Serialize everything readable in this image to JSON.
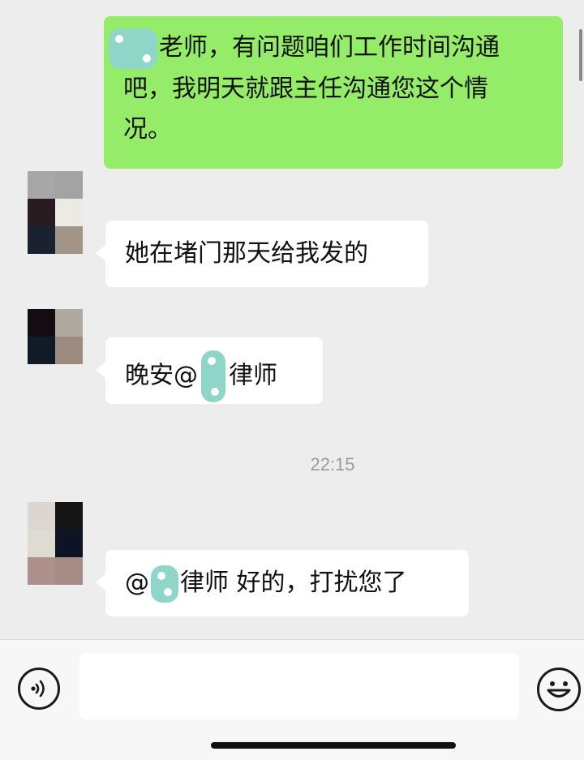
{
  "messages": [
    {
      "id": "m1",
      "direction": "outgoing",
      "text_line1": "老师，有问题咱们工作时间沟通",
      "text_line2": "吧，我明天就跟主任沟通您这个情",
      "text_line3": "况。"
    },
    {
      "id": "m2",
      "direction": "incoming",
      "text": "她在堵门那天给我发的"
    },
    {
      "id": "m3",
      "direction": "incoming",
      "text_before": "晚安@",
      "text_after": "律师"
    },
    {
      "id": "m4",
      "direction": "incoming",
      "text_before": "@",
      "text_after": "律师  好的，打扰您了"
    }
  ],
  "timestamp": "22:15",
  "input_bar": {
    "voice_icon": "voice-icon",
    "emoji_icon": "emoji-icon",
    "input_value": ""
  },
  "avatars": [
    {
      "colors": [
        "#a7a7a7",
        "#a3a3a3",
        "#271a20",
        "#ecebe3",
        "#1a2231",
        "#a09587"
      ]
    },
    {
      "colors": [
        "#130c13",
        "#afaa9f",
        "#111b27",
        "#9d8b7f"
      ]
    },
    {
      "colors": [
        "#dbd6d2",
        "#151515",
        "#dedbd2",
        "#0d1423",
        "#ae918d",
        "#a58c87"
      ]
    }
  ],
  "colors": {
    "outgoing_bubble": "#95ec69",
    "incoming_bubble": "#ffffff",
    "background": "#ededed",
    "redaction": "#8fd6c8"
  }
}
